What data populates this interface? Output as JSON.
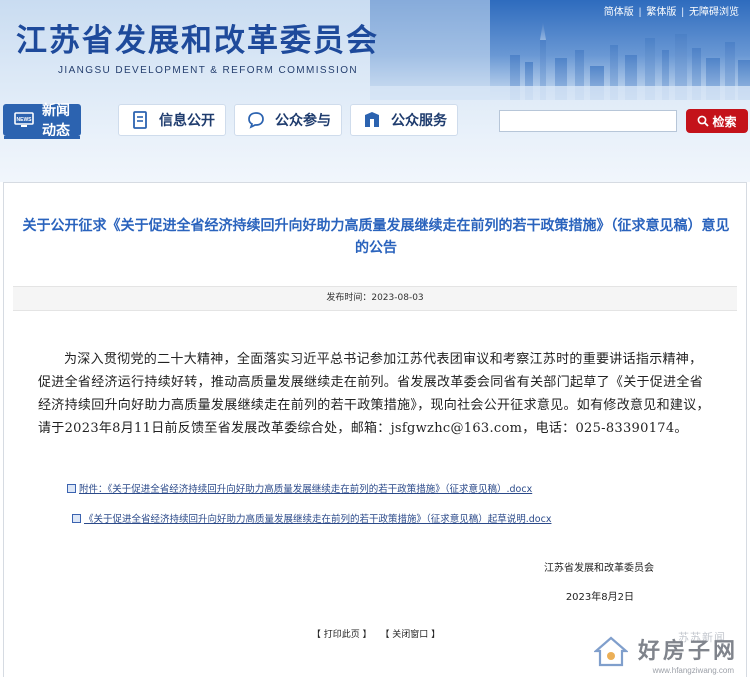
{
  "header": {
    "top_links": [
      "简体版",
      "繁体版",
      "无障碍浏览"
    ],
    "site_title": "江苏省发展和改革委员会",
    "site_subtitle": "JIANGSU DEVELOPMENT & REFORM COMMISSION"
  },
  "nav": {
    "items": [
      {
        "label": "新闻动态",
        "icon": "monitor-icon",
        "active": true
      },
      {
        "label": "信息公开",
        "icon": "document-icon",
        "active": false
      },
      {
        "label": "公众参与",
        "icon": "chat-icon",
        "active": false
      },
      {
        "label": "公众服务",
        "icon": "service-icon",
        "active": false
      }
    ]
  },
  "search": {
    "placeholder": "",
    "button_label": "检索"
  },
  "article": {
    "title": "关于公开征求《关于促进全省经济持续回升向好助力高质量发展继续走在前列的若干政策措施》（征求意见稿）意见的公告",
    "date_label": "发布时间：2023-08-03",
    "body": "为深入贯彻党的二十大精神，全面落实习近平总书记参加江苏代表团审议和考察江苏时的重要讲话指示精神，促进全省经济运行持续好转，推动高质量发展继续走在前列。省发展改革委会同省有关部门起草了《关于促进全省经济持续回升向好助力高质量发展继续走在前列的若干政策措施》，现向社会公开征求意见。如有修改意见和建议，请于2023年8月11日前反馈至省发展改革委综合处，邮箱：jsfgwzhc@163.com，电话：025-83390174。",
    "attachments": [
      "附件：《关于促进全省经济持续回升向好助力高质量发展继续走在前列的若干政策措施》（征求意见稿）.docx",
      "《关于促进全省经济持续回升向好助力高质量发展继续走在前列的若干政策措施》（征求意见稿）起草说明.docx"
    ],
    "signer": "江苏省发展和改革委员会",
    "sign_date": "2023年8月2日"
  },
  "footer": {
    "print_label": "【 打印此页 】",
    "close_label": "【 关闭窗口 】"
  },
  "watermark": {
    "text": "好房子网",
    "url": "www.hfangziwang.com",
    "media": "苏苏新闻"
  },
  "colors": {
    "title_blue": "#1e4a9b",
    "nav_active": "#2c63b0",
    "search_red": "#c4121a",
    "article_title": "#2a63bd"
  }
}
